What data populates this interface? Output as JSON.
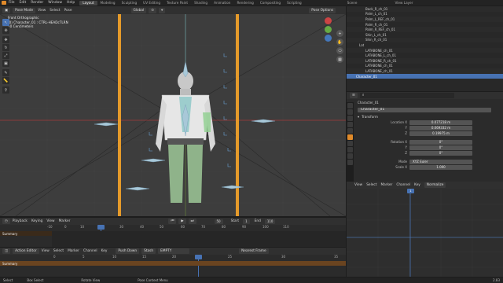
{
  "topbar": {
    "menus": [
      "File",
      "Edit",
      "Render",
      "Window",
      "Help"
    ],
    "workspaces": [
      "Layout",
      "Modeling",
      "Sculpting",
      "UV Editing",
      "Texture Paint",
      "Shading",
      "Animation",
      "Rendering",
      "Compositing",
      "Scripting"
    ],
    "active_workspace": "Layout",
    "scene": "Scene",
    "view_layer": "View Layer"
  },
  "viewport_header": {
    "mode": "Pose Mode",
    "menus": [
      "View",
      "Select",
      "Pose"
    ],
    "orientation": "Global",
    "overlay_label": "Pose Options"
  },
  "viewport_info": {
    "line1": "Front Orthographic",
    "line2": "(0) Character_01 : CTRL-HEADcTLRN",
    "line3": "10 Centimeters"
  },
  "outliner": {
    "rows": [
      "Back_R_ch_01",
      "Palm_L_ch_01",
      "Palm_L_REF_ch_01",
      "Palm_R_ch_01",
      "Palm_R_REF_ch_01",
      "Shin_L_ch_01",
      "Shin_R_ch_01",
      "Lat",
      "LATABONE_ch_01",
      "LATABONE_L_ch_01",
      "LATABONE_R_ch_01",
      "LATABONE_ch_01",
      "LATABONE_ch_01",
      "Character_01"
    ],
    "selected_index": 13
  },
  "properties": {
    "object_name": "Character_01",
    "data_name": "Character_01",
    "section": "Transform",
    "location_label": "Location X",
    "location": [
      "0.077218 m",
      "0.069332 m",
      "0.19975 m"
    ],
    "y_label": "Y",
    "z_label": "Z",
    "rotation_label": "Rotation X",
    "rotation": [
      "0°",
      "0°",
      "0°"
    ],
    "mode_label": "Mode",
    "mode": "XYZ Euler",
    "scale_label": "Scale X",
    "scale": "1.000"
  },
  "timeline": {
    "menus": [
      "Playback",
      "Keying",
      "View",
      "Marker"
    ],
    "current_frame": "50",
    "start_label": "Start",
    "start": "1",
    "end_label": "End",
    "end": "110",
    "ticks": [
      "-10",
      "0",
      "10",
      "20",
      "30",
      "40",
      "50",
      "60",
      "70",
      "80",
      "90",
      "100",
      "110"
    ],
    "summary_label": "Summary"
  },
  "action_editor": {
    "mode": "Action Editor",
    "menus": [
      "View",
      "Select",
      "Marker",
      "Channel",
      "Key"
    ],
    "push_down": "Push Down",
    "stash": "Stash",
    "action_name": "EMPTY",
    "nearest_frame": "Nearest Frame",
    "ticks": [
      "0",
      "5",
      "10",
      "15",
      "20",
      "25",
      "30",
      "35"
    ],
    "summary_label": "Summary"
  },
  "graph_editor": {
    "menus": [
      "View",
      "Select",
      "Marker",
      "Channel",
      "Key"
    ],
    "normalize": "Normalize",
    "current_frame": "1"
  },
  "statusbar": {
    "items": [
      "Select",
      "Box Select",
      "Rotate View",
      "Pose Context Menu"
    ],
    "version": "2.83"
  },
  "colors": {
    "accent": "#4772b3",
    "rig_orange": "#e59a2a",
    "summary": "#5a3a1e"
  }
}
